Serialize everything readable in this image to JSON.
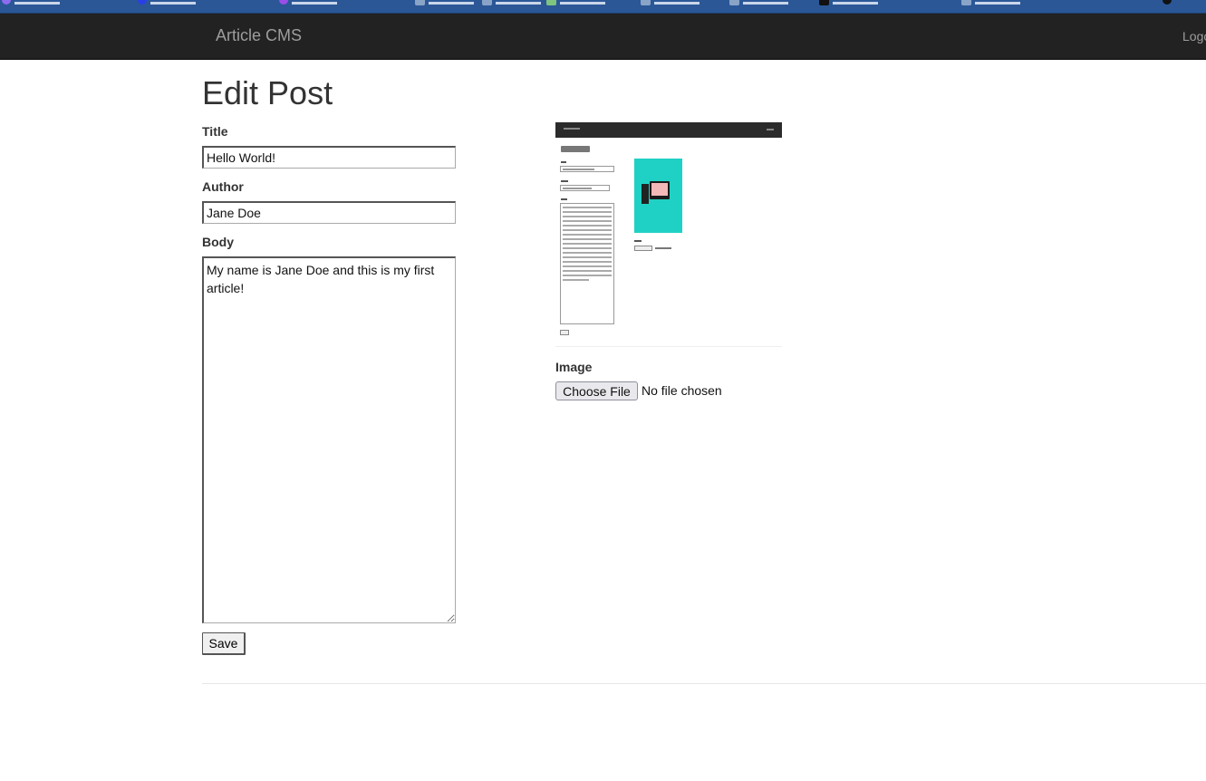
{
  "navbar": {
    "brand": "Article CMS",
    "logout": "Logout",
    "background": "#222222"
  },
  "page": {
    "title": "Edit Post"
  },
  "form": {
    "title_label": "Title",
    "title_value": "Hello World!",
    "author_label": "Author",
    "author_value": "Jane Doe",
    "body_label": "Body",
    "body_value": "My name is Jane Doe and this is my first article!",
    "save_label": "Save",
    "image_label": "Image",
    "choose_file_label": "Choose File",
    "file_status": "No file chosen"
  },
  "preview": {
    "icon": "article-image-thumbnail",
    "accent": "#1fd1c4"
  }
}
